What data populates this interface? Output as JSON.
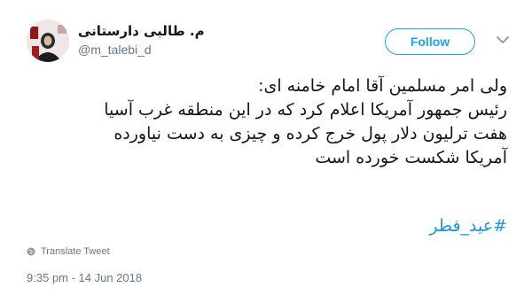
{
  "author": {
    "display_name": "م. طالبی دارستانی",
    "handle": "@m_talebi_d"
  },
  "follow_button": {
    "label": "Follow"
  },
  "tweet": {
    "lines": [
      "ولی امر مسلمین آقا امام خامنه ای:",
      "رئیس جمهور آمریکا اعلام کرد که در این منطقه غرب آسیا",
      "هفت ترلیون دلار پول خرج کرده و چیزی به دست نیاورده",
      "آمریکا شکست خورده است"
    ],
    "hashtag": "#عید_فطر"
  },
  "translate": {
    "label": "Translate Tweet"
  },
  "timestamp": "9:35 pm - 14 Jun 2018",
  "colors": {
    "accent": "#1da1f2",
    "link": "#1b95e0",
    "muted": "#657786",
    "text": "#14171a"
  },
  "icons": {
    "more": "chevron-down-icon",
    "translate": "globe-icon"
  }
}
